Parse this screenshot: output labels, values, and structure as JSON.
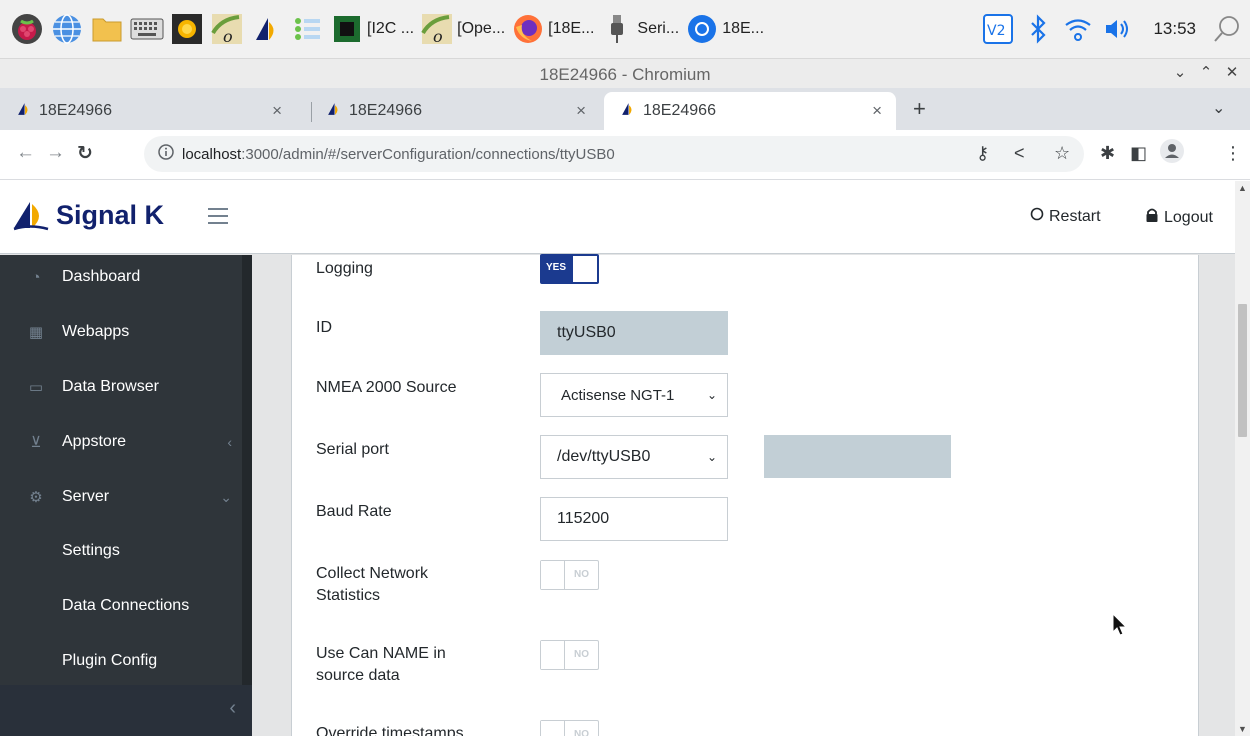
{
  "taskbar": {
    "tasks": [
      {
        "label": "[I2C ..."
      },
      {
        "label": "[Ope..."
      },
      {
        "label": "[18E..."
      },
      {
        "label": "Seri..."
      },
      {
        "label": "18E..."
      }
    ],
    "clock": "13:53"
  },
  "browser": {
    "window_title": "18E24966 - Chromium",
    "tabs": [
      {
        "title": "18E24966",
        "active": false
      },
      {
        "title": "18E24966",
        "active": false
      },
      {
        "title": "18E24966",
        "active": true
      }
    ],
    "url_host": "localhost",
    "url_path": ":3000/admin/#/serverConfiguration/connections/ttyUSB0"
  },
  "app": {
    "brand": "Signal K",
    "restart_label": "Restart",
    "logout_label": "Logout",
    "sidebar": {
      "items": [
        {
          "label": "Dashboard",
          "icon": "speedometer-icon"
        },
        {
          "label": "Webapps",
          "icon": "grid-icon"
        },
        {
          "label": "Data Browser",
          "icon": "folder-icon"
        },
        {
          "label": "Appstore",
          "icon": "basket-icon"
        },
        {
          "label": "Server",
          "icon": "settings-icon"
        }
      ],
      "sub_items": [
        {
          "label": "Settings"
        },
        {
          "label": "Data Connections"
        },
        {
          "label": "Plugin Config"
        }
      ]
    },
    "form": {
      "logging": {
        "label": "Logging",
        "state": "YES"
      },
      "id": {
        "label": "ID",
        "value": "ttyUSB0"
      },
      "nmea_source": {
        "label": "NMEA 2000 Source",
        "value": "Actisense NGT-1"
      },
      "serial_port": {
        "label": "Serial port",
        "value": "/dev/ttyUSB0"
      },
      "baud_rate": {
        "label": "Baud Rate",
        "value": "115200"
      },
      "collect_stats": {
        "label_line1": "Collect Network",
        "label_line2": "Statistics",
        "state": "NO"
      },
      "can_name": {
        "label_line1": "Use Can NAME in",
        "label_line2": "source data",
        "state": "NO"
      },
      "override_ts": {
        "label": "Override timestamps",
        "state": "NO"
      }
    }
  }
}
